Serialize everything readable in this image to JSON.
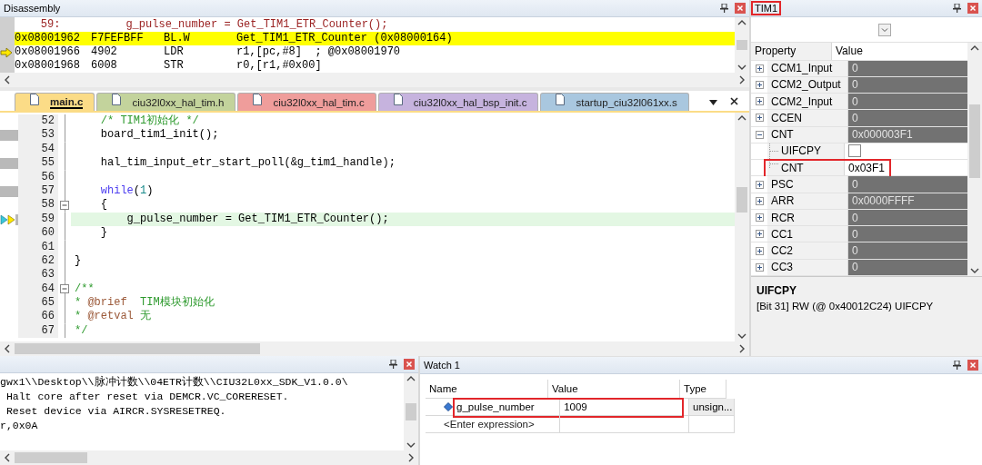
{
  "disassembly": {
    "title": "Disassembly",
    "rows": [
      {
        "kind": "source",
        "text": "    59:          g_pulse_number = Get_TIM1_ETR_Counter();"
      },
      {
        "kind": "instruction",
        "address": "0x08001962",
        "opcode": "F7FEFBFF",
        "mnemonic": "BL.W",
        "operands": "Get_TIM1_ETR_Counter (0x08000164)",
        "highlighted": true,
        "current": false
      },
      {
        "kind": "instruction",
        "address": "0x08001966",
        "opcode": "4902",
        "mnemonic": "LDR",
        "operands": "r1,[pc,#8]  ; @0x08001970",
        "highlighted": false,
        "current": true
      },
      {
        "kind": "instruction",
        "address": "0x08001968",
        "opcode": "6008",
        "mnemonic": "STR",
        "operands": "r0,[r1,#0x00]",
        "highlighted": false,
        "current": false
      }
    ]
  },
  "editor": {
    "tabs": [
      {
        "label": "main.c",
        "selected": true,
        "color": "#fbdc87"
      },
      {
        "label": "ciu32l0xx_hal_tim.h",
        "selected": false,
        "color": "#c3d39c"
      },
      {
        "label": "ciu32l0xx_hal_tim.c",
        "selected": false,
        "color": "#ef9d9b"
      },
      {
        "label": "ciu32l0xx_hal_bsp_init.c",
        "selected": false,
        "color": "#c6b3de"
      },
      {
        "label": "startup_ciu32l061xx.s",
        "selected": false,
        "color": "#a9c7df"
      }
    ],
    "lines": [
      {
        "number": "52",
        "exec": false,
        "current": false,
        "foldable": false,
        "code": [
          {
            "kind": "comment",
            "text": "    /* TIM1初始化 */"
          }
        ]
      },
      {
        "number": "53",
        "exec": true,
        "current": false,
        "foldable": false,
        "code": [
          {
            "kind": "plain",
            "text": "    board_tim1_init();"
          }
        ]
      },
      {
        "number": "54",
        "exec": false,
        "current": false,
        "foldable": false
      },
      {
        "number": "55",
        "exec": true,
        "current": false,
        "foldable": false,
        "code": [
          {
            "kind": "plain",
            "text": "    hal_tim_input_etr_start_poll(&g_tim1_handle);"
          }
        ]
      },
      {
        "number": "56",
        "exec": false,
        "current": false,
        "foldable": false
      },
      {
        "number": "57",
        "exec": true,
        "current": false,
        "foldable": false,
        "code": [
          {
            "kind": "keyword",
            "text": "    while"
          },
          {
            "kind": "plain",
            "text": "("
          },
          {
            "kind": "number",
            "text": "1"
          },
          {
            "kind": "plain",
            "text": ")"
          }
        ]
      },
      {
        "number": "58",
        "exec": false,
        "current": false,
        "foldable": true,
        "code": [
          {
            "kind": "plain",
            "text": "    {"
          }
        ]
      },
      {
        "number": "59",
        "exec": true,
        "current": true,
        "foldable": false,
        "code": [
          {
            "kind": "plain",
            "text": "        g_pulse_number = Get_TIM1_ETR_Counter();"
          }
        ]
      },
      {
        "number": "60",
        "exec": false,
        "current": false,
        "foldable": false,
        "code": [
          {
            "kind": "plain",
            "text": "    }"
          }
        ]
      },
      {
        "number": "61",
        "exec": false,
        "current": false,
        "foldable": false
      },
      {
        "number": "62",
        "exec": false,
        "current": false,
        "foldable": false,
        "code": [
          {
            "kind": "plain",
            "text": "}"
          }
        ]
      },
      {
        "number": "63",
        "exec": false,
        "current": false,
        "foldable": false
      },
      {
        "number": "64",
        "exec": false,
        "current": false,
        "foldable": true,
        "code": [
          {
            "kind": "comment",
            "text": "/**"
          }
        ]
      },
      {
        "number": "65",
        "exec": false,
        "current": false,
        "foldable": false,
        "code": [
          {
            "kind": "comment",
            "text": "* "
          },
          {
            "kind": "tag",
            "text": "@brief"
          },
          {
            "kind": "comment",
            "text": "  TIM模块初始化"
          }
        ]
      },
      {
        "number": "66",
        "exec": false,
        "current": false,
        "foldable": false,
        "code": [
          {
            "kind": "comment",
            "text": "* "
          },
          {
            "kind": "tag",
            "text": "@retval"
          },
          {
            "kind": "comment",
            "text": " 无"
          }
        ]
      },
      {
        "number": "67",
        "exec": false,
        "current": false,
        "foldable": false,
        "code": [
          {
            "kind": "comment",
            "text": "*/"
          }
        ]
      }
    ]
  },
  "registers": {
    "title": "TIM1",
    "title_highlighted": true,
    "columns": [
      "Property",
      "Value"
    ],
    "rows": [
      {
        "name": "CCM1_Input",
        "value": "0",
        "greyed": true,
        "expanded": false
      },
      {
        "name": "CCM2_Output",
        "value": "0",
        "greyed": true,
        "expanded": false
      },
      {
        "name": "CCM2_Input",
        "value": "0",
        "greyed": true,
        "expanded": false
      },
      {
        "name": "CCEN",
        "value": "0",
        "greyed": true,
        "expanded": false
      },
      {
        "name": "CNT",
        "value": "0x000003F1",
        "greyed": true,
        "expanded": true,
        "children": [
          {
            "kind": "checkbox",
            "name": "UIFCPY",
            "checked": false,
            "highlighted": false
          },
          {
            "kind": "text",
            "name": "CNT",
            "value": "0x03F1",
            "highlighted": true
          }
        ]
      },
      {
        "name": "PSC",
        "value": "0",
        "greyed": true,
        "expanded": false
      },
      {
        "name": "ARR",
        "value": "0x0000FFFF",
        "greyed": true,
        "expanded": false
      },
      {
        "name": "RCR",
        "value": "0",
        "greyed": true,
        "expanded": false
      },
      {
        "name": "CC1",
        "value": "0",
        "greyed": true,
        "expanded": false
      },
      {
        "name": "CC2",
        "value": "0",
        "greyed": true,
        "expanded": false
      },
      {
        "name": "CC3",
        "value": "0",
        "greyed": true,
        "expanded": false
      }
    ],
    "description": {
      "title": "UIFCPY",
      "text": "[Bit 31] RW (@ 0x40012C24) UIFCPY"
    }
  },
  "command": {
    "lines": [
      "gwx1\\\\Desktop\\\\脉冲计数\\\\04ETR计数\\\\CIU32L0xx_SDK_V1.0.0\\",
      " Halt core after reset via DEMCR.VC_CORERESET.",
      " Reset device via AIRCR.SYSRESETREQ.",
      "r,0x0A"
    ]
  },
  "watch": {
    "title": "Watch 1",
    "columns": [
      "Name",
      "Value",
      "Type"
    ],
    "rows": [
      {
        "kind": "variable",
        "name": "g_pulse_number",
        "value": "1009",
        "type": "unsign...",
        "highlighted": true
      },
      {
        "kind": "placeholder",
        "name": "<Enter expression>"
      }
    ]
  }
}
